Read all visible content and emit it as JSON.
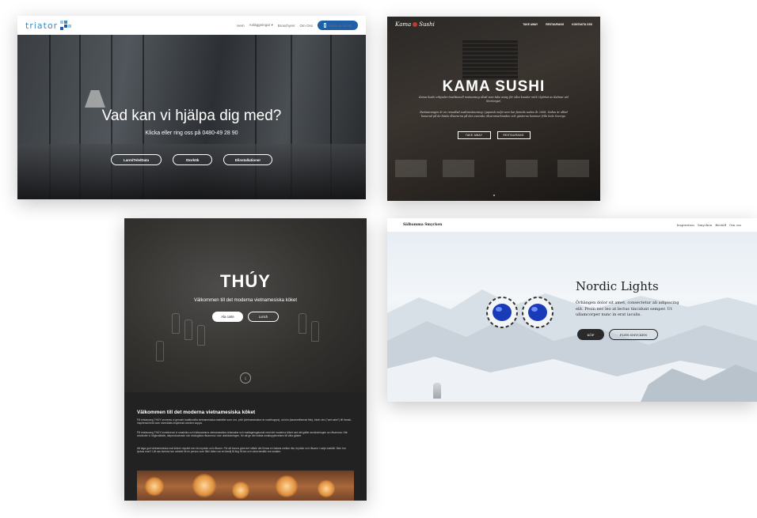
{
  "triator": {
    "logo": "triator",
    "nav": [
      "Hem",
      "Anläggningar ▾",
      "Broschyrer",
      "Om Oss"
    ],
    "phone_button": "0480-49 28 90",
    "hero_title": "Vad kan vi hjälpa dig med?",
    "hero_subtitle": "Klicka eller ring oss på 0480-49 28 90",
    "buttons": [
      "Larm/Tele/Data",
      "Storkök",
      "Elinstallationer"
    ]
  },
  "kama": {
    "logo_left": "Kama",
    "logo_right": "Sushi",
    "nav": [
      "TAKE AWAY",
      "RESTAURANG",
      "KONTAKTA OSS"
    ],
    "title": "KAMA SUSHI",
    "p1": "Kama Sushi erbjuder traditionell restaurang såväl som take away för våra kunder mitt i hjärtat av Kalmar vid Stortorget.",
    "p2": "Restaurangen är en renodlad sushirestaurang i japansk miljö som har funnits sedan år 2008. Sedan är alltid baserad på de bästa råvarorna på den svenska råvarumarknaden och gästerna kommer från hela Sverige.",
    "buttons": [
      "TAKE AWAY",
      "RESTAURANG"
    ]
  },
  "thuy": {
    "title": "THÚY",
    "subtitle": "Välkommen till det moderna vietnamesiska köket",
    "buttons": [
      "Ala carte",
      "Lunch"
    ],
    "down_arrow": "chevron-down-icon",
    "section_title": "Välkommen till det moderna vietnamesiska köket",
    "p1": "På restaurang THÚY serveras vi genuint traditionella vietnamesiska maträtter som t.ex. phở (vietnamesiska ris nudelsoppa), cà kho (karamelliserad fisk), bánh xèo (\"wet cake\") till fransk-inspirerad bröd som utvecklats inspirerad worden soppa.",
    "p2": "På restaurang THÚY kombinerar vi smakrika och hälsosamma vietnamesiska örtsmaker och matlagningskonst med det moderna köket vad det gäller användningen av råvarorna. Här använder vi högkvalitativ, närproducerade och ekologiska råvarorna i stor utsträckningen, för att ge den bästa smakupplevelsen till våra gäster.",
    "p3": "Att laga god vietnamesiska mat kräver mycket mer än kryddor och råvaror. För att kunna göra det måste det finnas en balans mellan råa, kryddor och råvaror i varje maträtt. Men hur lyckas man? Låt oss äventa hon arbetet till en person som fått i täten var en familj få ting få bra och väna bestille era smaker."
  },
  "nordic": {
    "logo": "Sälbamma Smycken",
    "nav": [
      "Inspiration",
      "Smycken",
      "Beställ",
      "Om oss"
    ],
    "title": "Nordic Lights",
    "text": "Örhängen dolor sit amet, consectetur ali adipiscing elit. Proin nec leo at lectus tincidunt semper. Ut ullamcorper nunc in erat iaculis.",
    "buy_button": "KÖP",
    "more_button": "FLER SMYCKEN",
    "accent": "#1a3bb8"
  }
}
